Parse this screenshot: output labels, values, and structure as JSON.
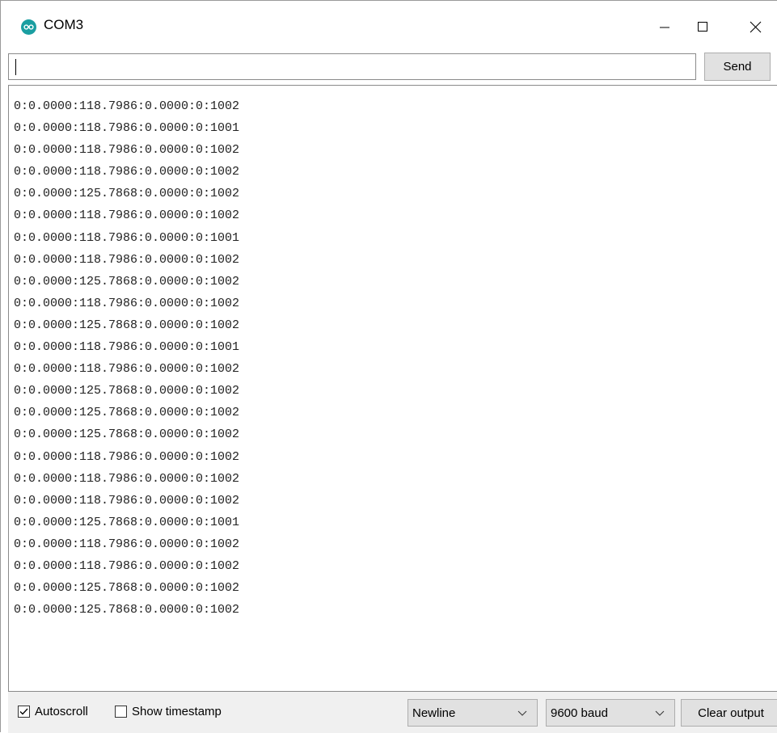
{
  "window": {
    "title": "COM3",
    "accent_color": "#1a9ea1"
  },
  "send_row": {
    "input_value": "",
    "send_label": "Send"
  },
  "output": {
    "lines": [
      "0:0.0000:118.7986:0.0000:0:1002",
      "0:0.0000:118.7986:0.0000:0:1001",
      "0:0.0000:118.7986:0.0000:0:1002",
      "0:0.0000:118.7986:0.0000:0:1002",
      "0:0.0000:125.7868:0.0000:0:1002",
      "0:0.0000:118.7986:0.0000:0:1002",
      "0:0.0000:118.7986:0.0000:0:1001",
      "0:0.0000:118.7986:0.0000:0:1002",
      "0:0.0000:125.7868:0.0000:0:1002",
      "0:0.0000:118.7986:0.0000:0:1002",
      "0:0.0000:125.7868:0.0000:0:1002",
      "0:0.0000:118.7986:0.0000:0:1001",
      "0:0.0000:118.7986:0.0000:0:1002",
      "0:0.0000:125.7868:0.0000:0:1002",
      "0:0.0000:125.7868:0.0000:0:1002",
      "0:0.0000:125.7868:0.0000:0:1002",
      "0:0.0000:118.7986:0.0000:0:1002",
      "0:0.0000:118.7986:0.0000:0:1002",
      "0:0.0000:118.7986:0.0000:0:1002",
      "0:0.0000:125.7868:0.0000:0:1001",
      "0:0.0000:118.7986:0.0000:0:1002",
      "0:0.0000:118.7986:0.0000:0:1002",
      "0:0.0000:125.7868:0.0000:0:1002",
      "0:0.0000:125.7868:0.0000:0:1002"
    ]
  },
  "status": {
    "autoscroll_label": "Autoscroll",
    "autoscroll_checked": true,
    "timestamp_label": "Show timestamp",
    "timestamp_checked": false,
    "line_ending": "Newline",
    "baud_rate": "9600 baud",
    "clear_label": "Clear output"
  }
}
